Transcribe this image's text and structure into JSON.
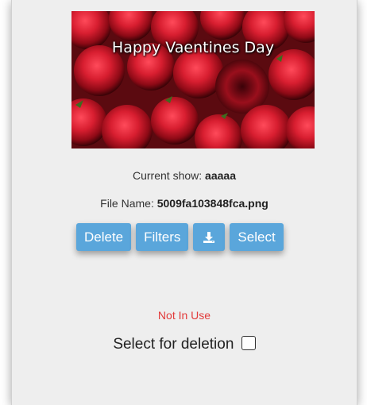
{
  "preview": {
    "caption": "Happy Vaentines Day",
    "image_description": "red-roses-photo"
  },
  "details": {
    "current_show_label": "Current show:",
    "current_show_value": "aaaaa",
    "file_name_label": "File Name:",
    "file_name_value": "5009fa103848fca.png"
  },
  "actions": {
    "delete_label": "Delete",
    "filters_label": "Filters",
    "download_icon": "download-icon",
    "select_label": "Select"
  },
  "status": {
    "text": "Not In Use"
  },
  "deletion": {
    "label": "Select for deletion",
    "checked": false
  },
  "colors": {
    "button_bg": "#5aa6db",
    "status_red": "#e23a3a",
    "card_bg": "#eeeeee"
  }
}
